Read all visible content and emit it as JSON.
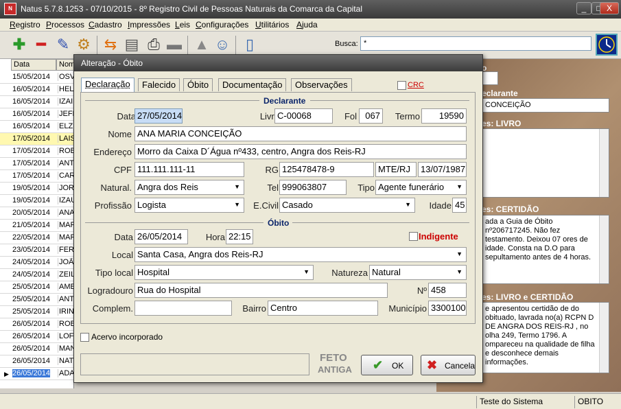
{
  "window": {
    "title": "Natus 5.7.8.1253 - 07/10/2015 - 8º Registro Civil de Pessoas Naturais da Comarca da Capital",
    "min": "_",
    "max": "□",
    "close": "X"
  },
  "menu": [
    "Registro",
    "Processos",
    "Cadastro",
    "Impressões",
    "Leis",
    "Configurações",
    "Utilitários",
    "Ajuda"
  ],
  "search": {
    "label": "Busca:",
    "value": "*"
  },
  "list": {
    "headers": [
      "Data",
      "Nom"
    ],
    "rows": [
      {
        "date": "15/05/2014",
        "name": "OSV"
      },
      {
        "date": "16/05/2014",
        "name": "HEL"
      },
      {
        "date": "16/05/2014",
        "name": "IZAI"
      },
      {
        "date": "16/05/2014",
        "name": "JEFI"
      },
      {
        "date": "16/05/2014",
        "name": "ELZ"
      },
      {
        "date": "17/05/2014",
        "name": "LAIS"
      },
      {
        "date": "17/05/2014",
        "name": "ROB"
      },
      {
        "date": "17/05/2014",
        "name": "ANT"
      },
      {
        "date": "17/05/2014",
        "name": "CAR"
      },
      {
        "date": "19/05/2014",
        "name": "JOR"
      },
      {
        "date": "19/05/2014",
        "name": "IZAU"
      },
      {
        "date": "20/05/2014",
        "name": "ANA"
      },
      {
        "date": "21/05/2014",
        "name": "MAR"
      },
      {
        "date": "22/05/2014",
        "name": "MAR"
      },
      {
        "date": "23/05/2014",
        "name": "FER"
      },
      {
        "date": "24/05/2014",
        "name": "JOÃ"
      },
      {
        "date": "24/05/2014",
        "name": "ZEIL"
      },
      {
        "date": "25/05/2014",
        "name": "AME"
      },
      {
        "date": "25/05/2014",
        "name": "ANT"
      },
      {
        "date": "25/05/2014",
        "name": "IRIN"
      },
      {
        "date": "26/05/2014",
        "name": "ROB"
      },
      {
        "date": "26/05/2014",
        "name": "LOF"
      },
      {
        "date": "26/05/2014",
        "name": "MAN"
      },
      {
        "date": "26/05/2014",
        "name": "NAT"
      },
      {
        "date": "26/05/2014",
        "name": "ADA"
      }
    ]
  },
  "right_panel": {
    "frag_top": "o",
    "declarante_label": "eclarante",
    "declarante_value": "CONCEIÇÃO",
    "livro_label": "es: LIVRO",
    "certidao_label": "es: CERTIDÃO",
    "certidao_text": "ada a Guia de Óbito nº206717245. Não fez testamento. Deixou 07 ores de idade. Consta na D.O para sepultamento antes de 4 horas.",
    "livro_cert_label": "es: LIVRO e CERTIDÃO",
    "livro_cert_text": "e apresentou certidão de do obituado, lavrada no(a) RCPN D DE ANGRA DOS REIS-RJ , no olha 249, Termo 1796. A ompareceu na qualidade de filha e desconhece demais informações."
  },
  "status": {
    "user": "Teste do Sistema",
    "module": "OBITO"
  },
  "dialog": {
    "title": "Alteração - Óbito",
    "tabs": [
      "Declaração",
      "Falecido",
      "Óbito",
      "Documentação",
      "Observações"
    ],
    "crc_label": "CRC",
    "declarante": {
      "section": "Declarante",
      "data_label": "Data",
      "data": "27/05/2014",
      "livro_label": "Livro",
      "livro": "C-00068",
      "fol_label": "Fol",
      "fol": "067",
      "termo_label": "Termo",
      "termo": "19590",
      "nome_label": "Nome",
      "nome": "ANA MARIA CONCEIÇÃO",
      "endereco_label": "Endereço",
      "endereco": "Morro da Caixa D´Água nº433, centro, Angra dos Reis-RJ",
      "cpf_label": "CPF",
      "cpf": "111.111.111-11",
      "rg_label": "RG",
      "rg": "125478478-9",
      "rg_org": "MTE/RJ",
      "rg_date": "13/07/1987",
      "natural_label": "Natural.",
      "natural": "Angra dos Reis",
      "tel_label": "Tel",
      "tel": "999063807",
      "tipo_label": "Tipo",
      "tipo": "Agente funerário",
      "profissao_label": "Profissão",
      "profissao": "Logista",
      "ecivil_label": "E.Civil",
      "ecivil": "Casado",
      "idade_label": "Idade",
      "idade": "45"
    },
    "obito": {
      "section": "Óbito",
      "data_label": "Data",
      "data": "26/05/2014",
      "hora_label": "Hora",
      "hora": "22:15",
      "indigente_label": "Indigente",
      "local_label": "Local",
      "local": "Santa Casa, Angra dos Reis-RJ",
      "tipo_local_label": "Tipo local",
      "tipo_local": "Hospital",
      "natureza_label": "Natureza",
      "natureza": "Natural",
      "logradouro_label": "Logradouro",
      "logradouro": "Rua do Hospital",
      "numero_label": "Nº",
      "numero": "458",
      "complem_label": "Complem.",
      "complem": "",
      "bairro_label": "Bairro",
      "bairro": "Centro",
      "municipio_label": "Município",
      "municipio": "3300100"
    },
    "acervo_label": "Acervo incorporado",
    "feto_label": "FETO",
    "antiga_label": "ANTIGA",
    "ok_label": "OK",
    "cancel_label": "Cancela"
  }
}
